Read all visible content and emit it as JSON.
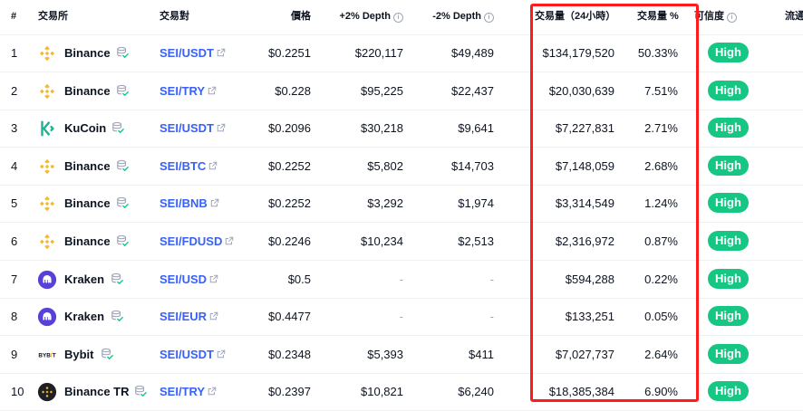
{
  "columns": {
    "rank": "#",
    "exchange": "交易所",
    "pair": "交易對",
    "price": "價格",
    "depth_plus": "+2% Depth",
    "depth_minus": "-2% Depth",
    "volume": "交易量（24小時）",
    "volume_pct": "交易量 %",
    "confidence": "可信度",
    "liquidity": "流通"
  },
  "colors": {
    "high_badge": "#16c784",
    "link": "#3861fb",
    "highlight_box": "#ff1b1b"
  },
  "rows": [
    {
      "rank": "1",
      "exchange": "Binance",
      "logo": "binance-logo",
      "pair": "SEI/USDT",
      "price": "$0.2251",
      "depth_plus": "$220,117",
      "depth_minus": "$49,489",
      "volume": "$134,179,520",
      "volume_pct": "50.33%",
      "confidence": "High"
    },
    {
      "rank": "2",
      "exchange": "Binance",
      "logo": "binance-logo",
      "pair": "SEI/TRY",
      "price": "$0.228",
      "depth_plus": "$95,225",
      "depth_minus": "$22,437",
      "volume": "$20,030,639",
      "volume_pct": "7.51%",
      "confidence": "High"
    },
    {
      "rank": "3",
      "exchange": "KuCoin",
      "logo": "kucoin-logo",
      "pair": "SEI/USDT",
      "price": "$0.2096",
      "depth_plus": "$30,218",
      "depth_minus": "$9,641",
      "volume": "$7,227,831",
      "volume_pct": "2.71%",
      "confidence": "High"
    },
    {
      "rank": "4",
      "exchange": "Binance",
      "logo": "binance-logo",
      "pair": "SEI/BTC",
      "price": "$0.2252",
      "depth_plus": "$5,802",
      "depth_minus": "$14,703",
      "volume": "$7,148,059",
      "volume_pct": "2.68%",
      "confidence": "High"
    },
    {
      "rank": "5",
      "exchange": "Binance",
      "logo": "binance-logo",
      "pair": "SEI/BNB",
      "price": "$0.2252",
      "depth_plus": "$3,292",
      "depth_minus": "$1,974",
      "volume": "$3,314,549",
      "volume_pct": "1.24%",
      "confidence": "High"
    },
    {
      "rank": "6",
      "exchange": "Binance",
      "logo": "binance-logo",
      "pair": "SEI/FDUSD",
      "price": "$0.2246",
      "depth_plus": "$10,234",
      "depth_minus": "$2,513",
      "volume": "$2,316,972",
      "volume_pct": "0.87%",
      "confidence": "High"
    },
    {
      "rank": "7",
      "exchange": "Kraken",
      "logo": "kraken-logo",
      "pair": "SEI/USD",
      "price": "$0.5",
      "depth_plus": "-",
      "depth_minus": "-",
      "volume": "$594,288",
      "volume_pct": "0.22%",
      "confidence": "High"
    },
    {
      "rank": "8",
      "exchange": "Kraken",
      "logo": "kraken-logo",
      "pair": "SEI/EUR",
      "price": "$0.4477",
      "depth_plus": "-",
      "depth_minus": "-",
      "volume": "$133,251",
      "volume_pct": "0.05%",
      "confidence": "High"
    },
    {
      "rank": "9",
      "exchange": "Bybit",
      "logo": "bybit-logo",
      "pair": "SEI/USDT",
      "price": "$0.2348",
      "depth_plus": "$5,393",
      "depth_minus": "$411",
      "volume": "$7,027,737",
      "volume_pct": "2.64%",
      "confidence": "High"
    },
    {
      "rank": "10",
      "exchange": "Binance TR",
      "logo": "binance-tr-logo",
      "pair": "SEI/TRY",
      "price": "$0.2397",
      "depth_plus": "$10,821",
      "depth_minus": "$6,240",
      "volume": "$18,385,384",
      "volume_pct": "6.90%",
      "confidence": "High"
    }
  ]
}
